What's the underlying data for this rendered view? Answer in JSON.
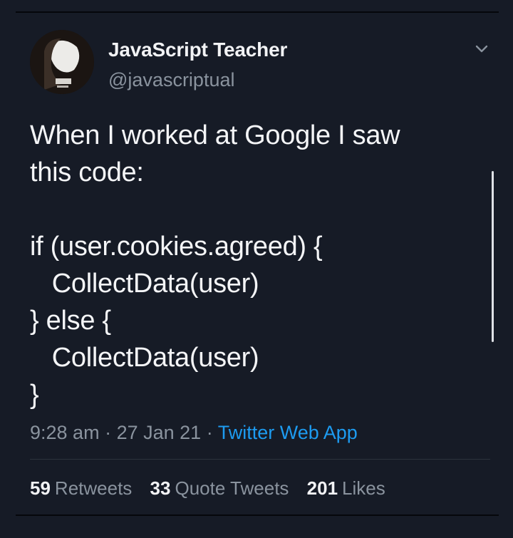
{
  "user": {
    "display_name": "JavaScript Teacher",
    "handle": "@javascriptual",
    "avatar_icon": "profile-photo"
  },
  "tweet": {
    "text": "When I worked at Google I saw\nthis code:\n\nif (user.cookies.agreed) {\n   CollectData(user)\n} else {\n   CollectData(user)\n}"
  },
  "meta": {
    "time": "9:28 am",
    "separator": "·",
    "date": "27 Jan 21",
    "source": "Twitter Web App"
  },
  "stats": {
    "retweets_count": "59",
    "retweets_label": "Retweets",
    "quotes_count": "33",
    "quotes_label": "Quote Tweets",
    "likes_count": "201",
    "likes_label": "Likes"
  },
  "colors": {
    "background": "#161b26",
    "text": "#f4f5f7",
    "muted": "#8a939e",
    "link": "#1d9bf0"
  }
}
